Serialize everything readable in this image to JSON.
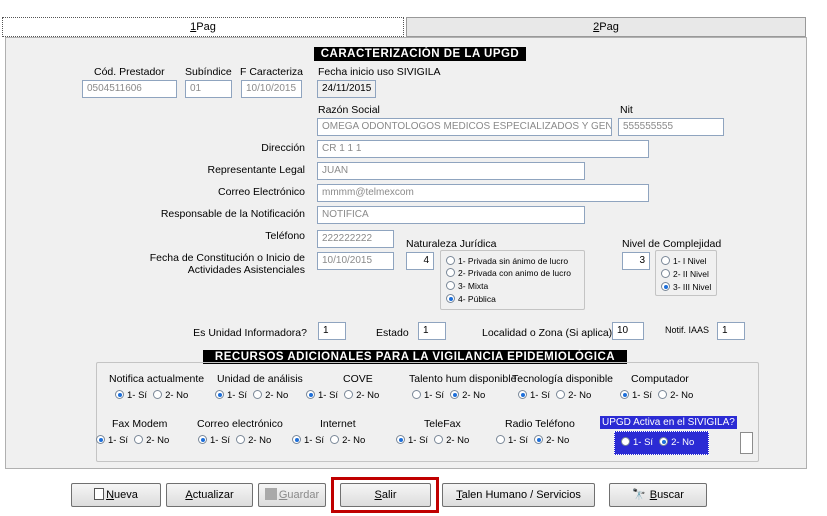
{
  "tabs": [
    {
      "hotkey": "1",
      "label": "Pag"
    },
    {
      "hotkey": "2",
      "label": "Pag"
    }
  ],
  "header_upgd": "CARACTERIZACIÓN DE LA UPGD",
  "header_recursos": "RECURSOS ADICIONALES PARA LA VIGILANCIA EPIDEMIOLÓGICA",
  "fields": {
    "cod_prestador": {
      "label": "Cód. Prestador",
      "value": "0504511606"
    },
    "subindice": {
      "label": "Subíndice",
      "value": "01"
    },
    "f_caracteriza": {
      "label": "F Caracteriza",
      "value": "10/10/2015"
    },
    "fecha_inicio": {
      "label": "Fecha inicio uso SIVIGILA",
      "value": "24/11/2015"
    },
    "razon_social": {
      "label": "Razón Social",
      "value": "OMEGA ODONTOLOGOS MEDICOS ESPECIALIZADOS Y GEN"
    },
    "nit": {
      "label": "Nit",
      "value": "555555555"
    },
    "direccion": {
      "label": "Dirección",
      "value": "CR 1 1 1"
    },
    "representante": {
      "label": "Representante Legal",
      "value": "JUAN"
    },
    "correo": {
      "label": "Correo Electrónico",
      "value": "mmmm@telmexcom"
    },
    "responsable": {
      "label": "Responsable de la Notificación",
      "value": "NOTIFICA"
    },
    "telefono": {
      "label": "Teléfono",
      "value": "222222222"
    },
    "fecha_constitucion": {
      "label1": "Fecha de Constitución o Inicio de",
      "label2": "Actividades Asistenciales",
      "value": "10/10/2015"
    },
    "es_unidad": {
      "label": "Es Unidad Informadora?",
      "value": "1"
    },
    "estado": {
      "label": "Estado",
      "value": "1"
    },
    "localidad": {
      "label": "Localidad o Zona (Si aplica)",
      "value": "10"
    },
    "notif_iaas": {
      "label": "Notif. IAAS",
      "value": "1"
    }
  },
  "naturaleza": {
    "label": "Naturaleza Jurídica",
    "value": "4",
    "options": [
      "1- Privada sin ánimo de lucro",
      "2- Privada con animo de lucro",
      "3- Mixta",
      "4- Pública"
    ],
    "selected": 3
  },
  "complejidad": {
    "label": "Nivel de Complejidad",
    "value": "3",
    "options": [
      "1- I  Nivel",
      "2- II Nivel",
      "3- III Nivel"
    ],
    "selected": 2
  },
  "recursos": [
    {
      "label": "Notifica actualmente",
      "yes": "1- Sí",
      "no": "2- No",
      "selected": "yes"
    },
    {
      "label": "Unidad de análisis",
      "yes": "1- Sí",
      "no": "2- No",
      "selected": "yes"
    },
    {
      "label": "COVE",
      "yes": "1- Sí",
      "no": "2- No",
      "selected": "yes"
    },
    {
      "label": "Talento hum disponible",
      "yes": "1- Sí",
      "no": "2- No",
      "selected": "no"
    },
    {
      "label": "Tecnología disponible",
      "yes": "1- Sí",
      "no": "2- No",
      "selected": "yes"
    },
    {
      "label": "Computador",
      "yes": "1- Sí",
      "no": "2- No",
      "selected": "yes"
    },
    {
      "label": "Fax Modem",
      "yes": "1- Sí",
      "no": "2- No",
      "selected": "yes"
    },
    {
      "label": "Correo electrónico",
      "yes": "1- Sí",
      "no": "2- No",
      "selected": "yes"
    },
    {
      "label": "Internet",
      "yes": "1- Sí",
      "no": "2- No",
      "selected": "yes"
    },
    {
      "label": "TeleFax",
      "yes": "1- Sí",
      "no": "2- No",
      "selected": "yes"
    },
    {
      "label": "Radio Teléfono",
      "yes": "1- Sí",
      "no": "2- No",
      "selected": "no"
    },
    {
      "label": "UPGD Activa en el SIVIGILA?",
      "yes": "1- Sí",
      "no": "2- No",
      "selected": "no"
    }
  ],
  "buttons": {
    "nueva": {
      "hotkey": "N",
      "rest": "ueva"
    },
    "actualizar": {
      "hotkey": "A",
      "rest": "ctualizar"
    },
    "guardar": {
      "hotkey": "G",
      "rest": "uardar"
    },
    "salir": {
      "hotkey": "S",
      "rest": "alir"
    },
    "talento": {
      "hotkey": "T",
      "rest": "alen Humano / Servicios"
    },
    "buscar": {
      "hotkey": "B",
      "rest": "uscar"
    }
  },
  "colors": {
    "highlight": "#c00000",
    "upgd_active_bg": "#2b2bd4",
    "radio_dot": "#1e6fd9"
  }
}
